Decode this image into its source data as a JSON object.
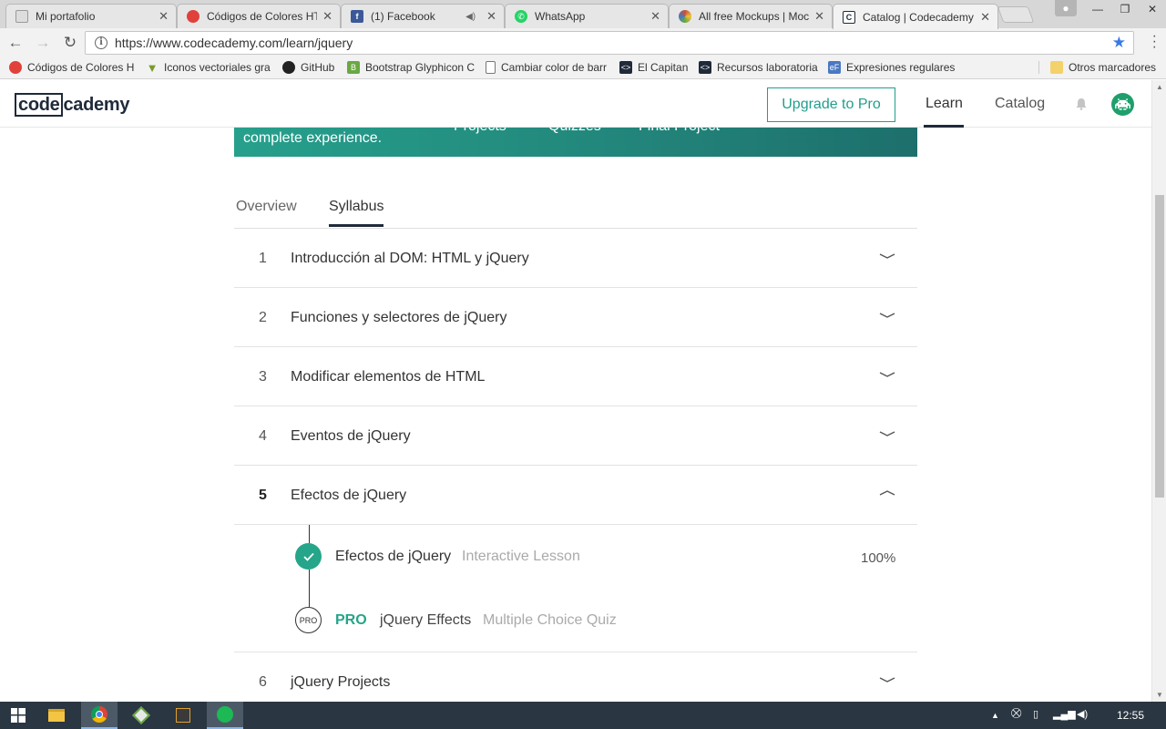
{
  "browser": {
    "tabs": [
      {
        "title": "Mi portafolio",
        "icon": "page-icon",
        "color": "#d0d0d0"
      },
      {
        "title": "Códigos de Colores HTML",
        "icon": "colorwheel-icon",
        "color": "#e0413b"
      },
      {
        "title": "(1) Facebook",
        "icon": "facebook-icon",
        "color": "#3b5998"
      },
      {
        "title": "WhatsApp",
        "icon": "whatsapp-icon",
        "color": "#25d366"
      },
      {
        "title": "All free Mockups | Mockups",
        "icon": "mockups-icon",
        "color": "#c94f3d"
      },
      {
        "title": "Catalog | Codecademy",
        "icon": "codecademy-icon",
        "color": "#1f2a3a"
      }
    ],
    "url": "https://www.codecademy.com/learn/jquery",
    "bookmarks": [
      {
        "label": "Códigos de Colores H",
        "icon": "colorwheel-icon",
        "color": "#e0413b"
      },
      {
        "label": "Iconos vectoriales gra",
        "icon": "vector-icon",
        "color": "#7a9a2a"
      },
      {
        "label": "GitHub",
        "icon": "github-icon",
        "color": "#222222"
      },
      {
        "label": "Bootstrap Glyphicon C",
        "icon": "bootstrap-icon",
        "color": "#6aa842"
      },
      {
        "label": "Cambiar color de barr",
        "icon": "page-icon",
        "color": "#ffffff"
      },
      {
        "label": "El Capitan",
        "icon": "code-icon",
        "color": "#1f2a3a"
      },
      {
        "label": "Recursos laboratoria",
        "icon": "code-icon",
        "color": "#1f2a3a"
      },
      {
        "label": "Expresiones regulares",
        "icon": "regex-icon",
        "color": "#4a78c2"
      }
    ],
    "other_bookmarks": "Otros marcadores"
  },
  "header": {
    "logo_left": "code",
    "logo_right": "cademy",
    "upgrade": "Upgrade to Pro",
    "learn": "Learn",
    "catalog": "Catalog"
  },
  "banner": {
    "text": "complete experience.",
    "items": [
      "Projects",
      "Quizzes",
      "Final Project"
    ]
  },
  "tabs": {
    "overview": "Overview",
    "syllabus": "Syllabus"
  },
  "syllabus": [
    {
      "num": "1",
      "title": "Introducción al DOM: HTML y jQuery"
    },
    {
      "num": "2",
      "title": "Funciones y selectores de jQuery"
    },
    {
      "num": "3",
      "title": "Modificar elementos de HTML"
    },
    {
      "num": "4",
      "title": "Eventos de jQuery"
    },
    {
      "num": "5",
      "title": "Efectos de jQuery"
    },
    {
      "num": "6",
      "title": "jQuery Projects"
    }
  ],
  "lessons": [
    {
      "title": "Efectos de jQuery",
      "type": "Interactive Lesson",
      "progress": "100%"
    },
    {
      "badge": "PRO",
      "pro_label": "PRO",
      "title": "jQuery Effects",
      "type": "Multiple Choice Quiz"
    }
  ],
  "taskbar": {
    "clock": "12:55"
  },
  "colors": {
    "accent": "#1f9f8b",
    "check": "#25a58a",
    "pro": "#25a58a"
  }
}
